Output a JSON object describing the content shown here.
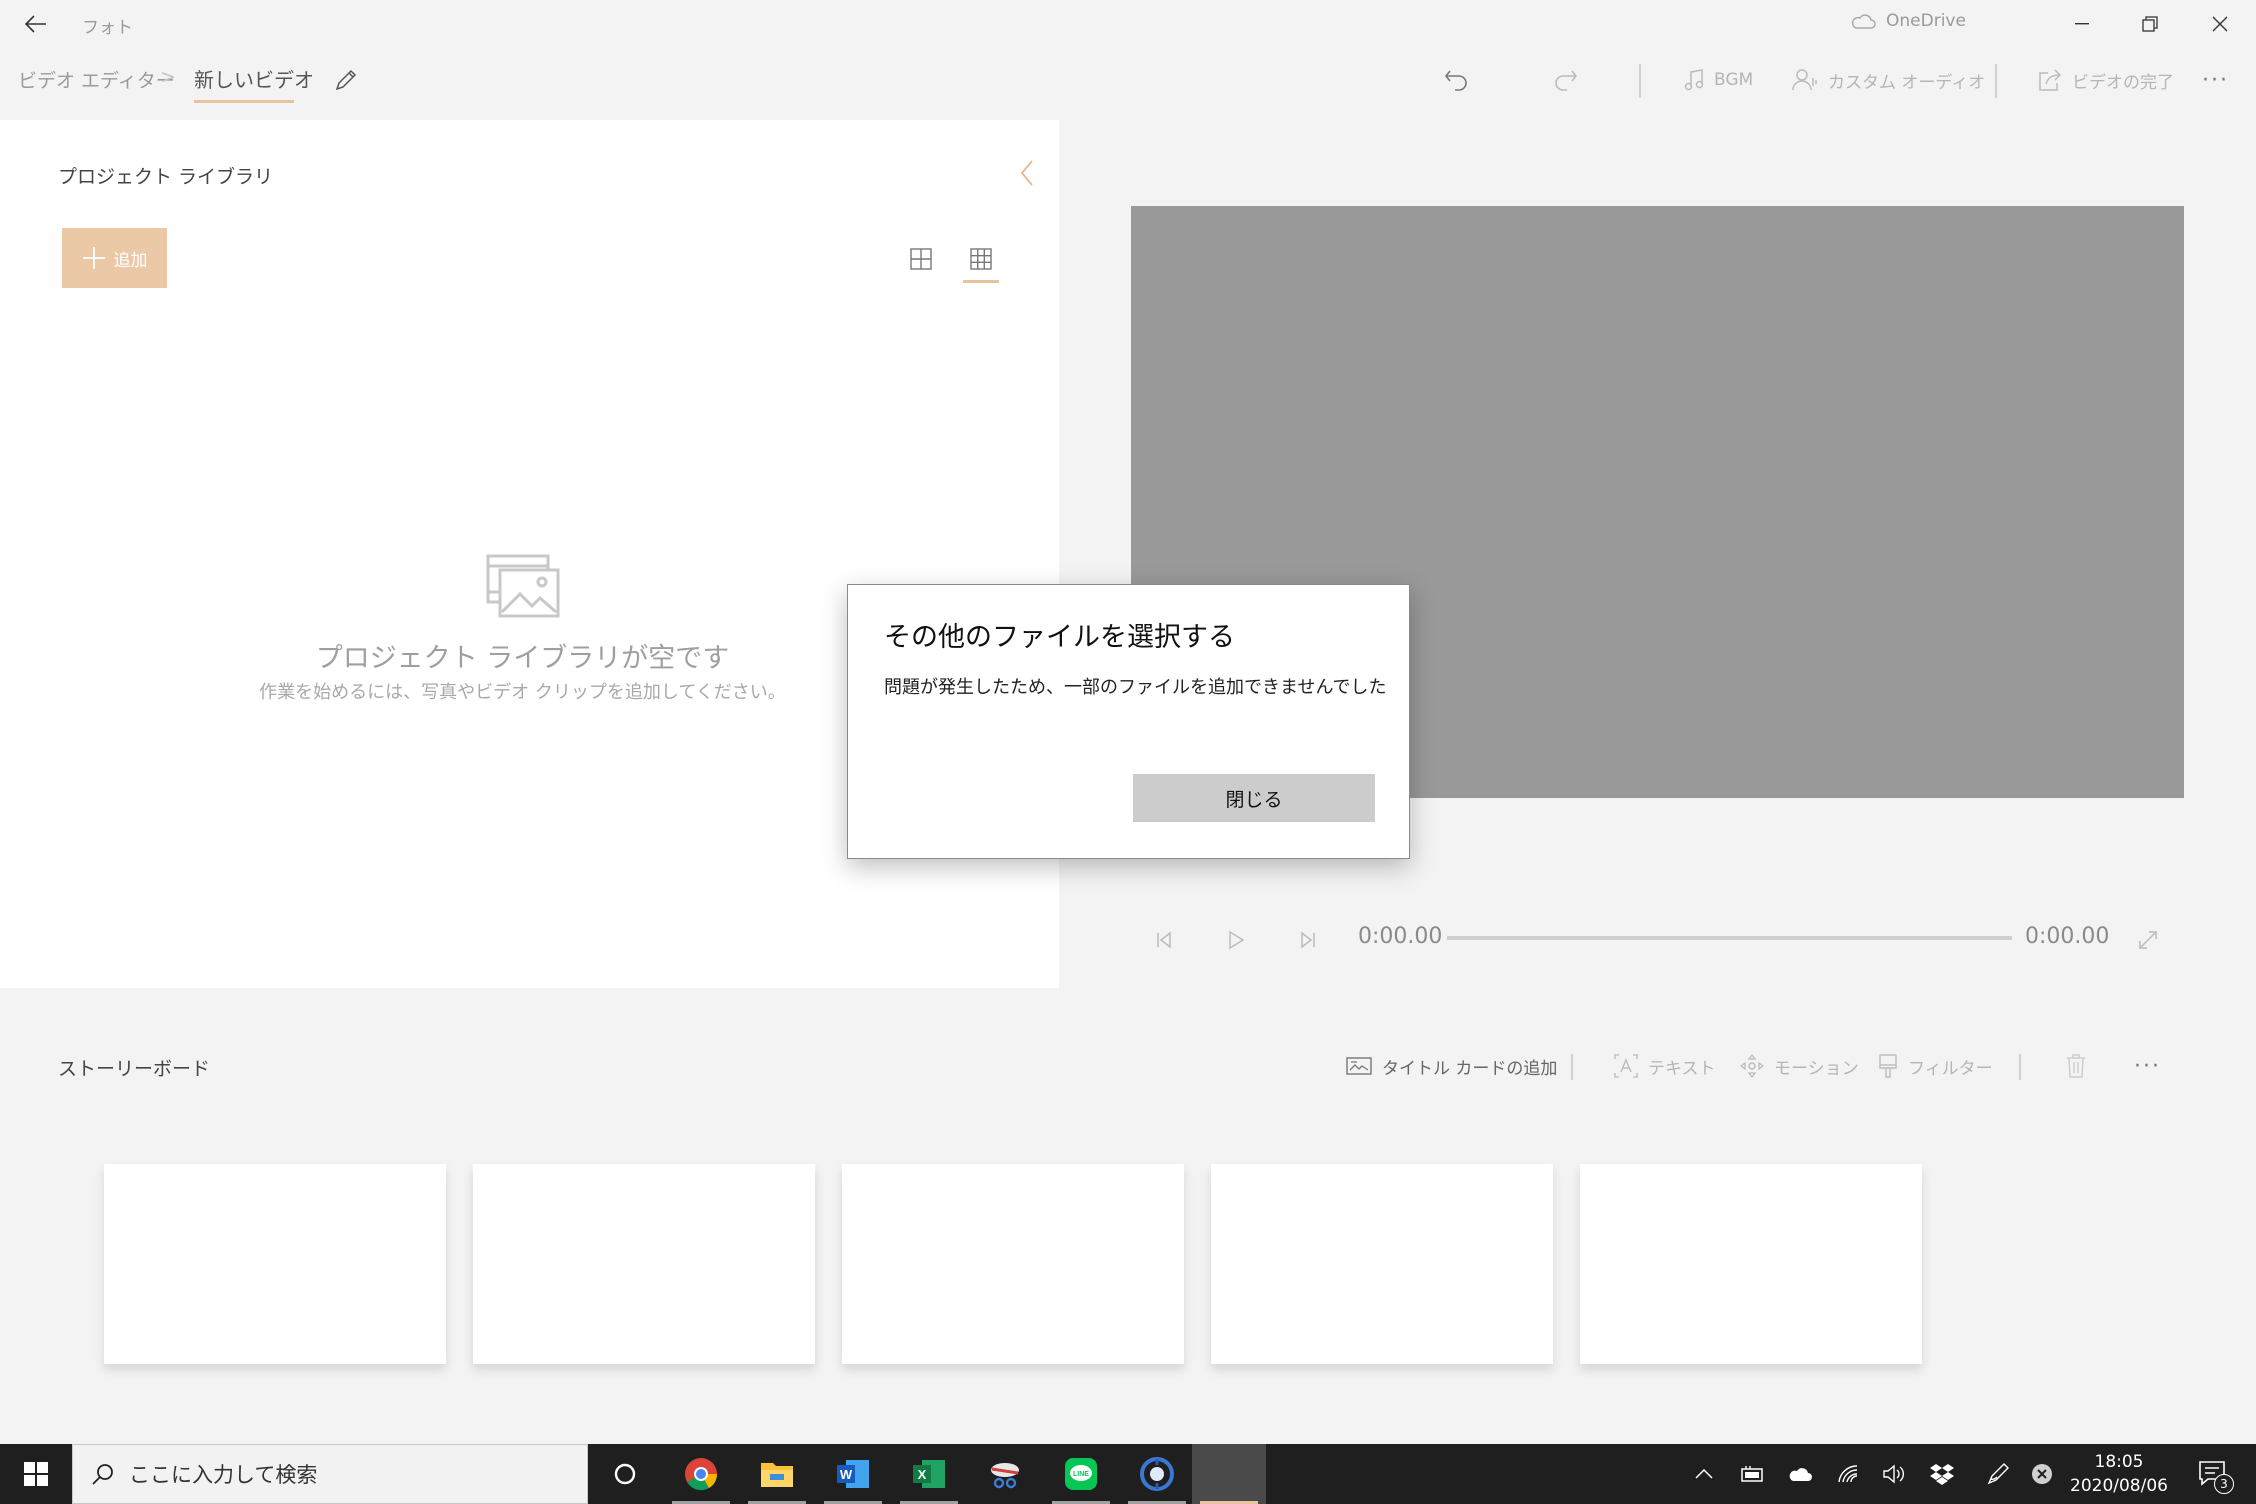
{
  "titlebar": {
    "app_title": "フォト",
    "onedrive_label": "OneDrive"
  },
  "breadcrumb": {
    "root": "ビデオ エディター",
    "separator": ">",
    "current": "新しいビデオ"
  },
  "toolbar": {
    "bgm": "BGM",
    "custom_audio": "カスタム オーディオ",
    "finish_video": "ビデオの完了",
    "more": "···"
  },
  "library": {
    "title": "プロジェクト ライブラリ",
    "add_label": "追加",
    "empty_title": "プロジェクト ライブラリが空です",
    "empty_subtitle": "作業を始めるには、写真やビデオ クリップを追加してください。"
  },
  "player": {
    "current_time": "0:00.00",
    "total_time": "0:00.00",
    "progress": 0
  },
  "storyboard": {
    "title": "ストーリーボード",
    "add_title_card": "タイトル カードの追加",
    "text": "テキスト",
    "motion": "モーション",
    "filters": "フィルター",
    "more": "···",
    "empty_slots": 5
  },
  "dialog": {
    "title": "その他のファイルを選択する",
    "message": "問題が発生したため、一部のファイルを追加できませんでした",
    "close_label": "閉じる"
  },
  "taskbar": {
    "search_placeholder": "ここに入力して検索",
    "apps": [
      "cortana-icon",
      "chrome-icon",
      "file-explorer-icon",
      "word-icon",
      "excel-icon",
      "snipping-tool-icon",
      "line-icon",
      "app-icon",
      "active-app"
    ],
    "clock_time": "18:05",
    "clock_date": "2020/08/06",
    "notification_count": "3"
  },
  "colors": {
    "accent": "#ecc9a6",
    "accent_underline": "#e8c39e",
    "preview_bg": "#999999",
    "taskbar_bg": "#1f1f1f"
  }
}
